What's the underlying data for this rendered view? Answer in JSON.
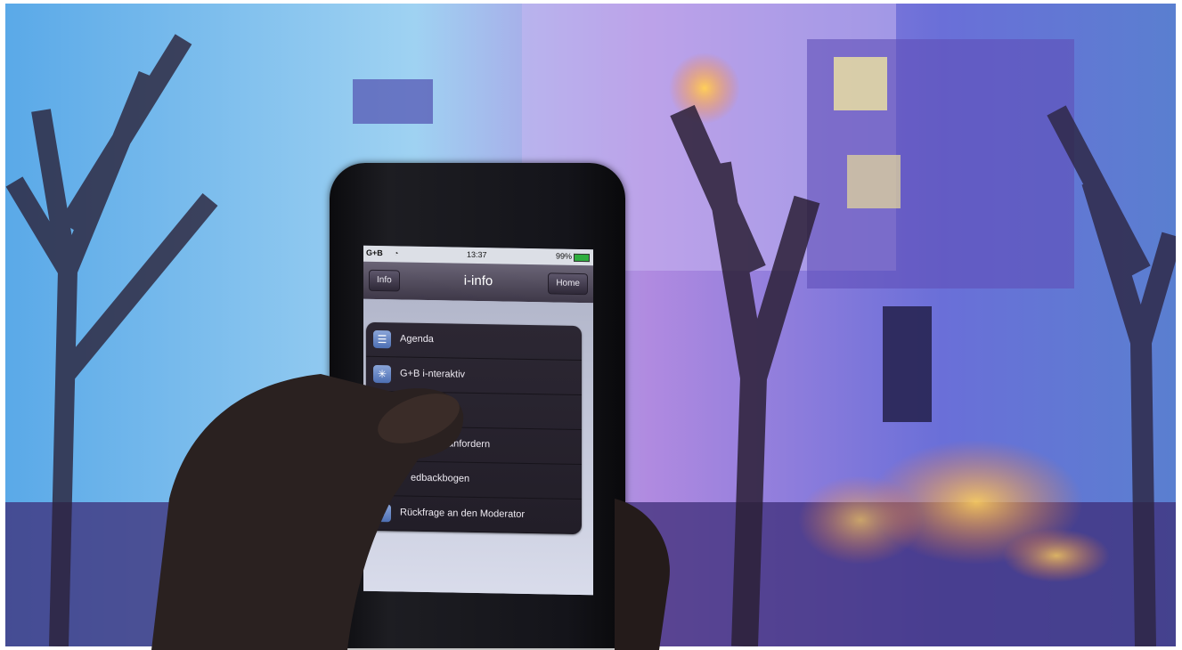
{
  "status": {
    "carrier": "G+B",
    "time": "13:37",
    "battery": "99%"
  },
  "nav": {
    "left_button": "Info",
    "title": "i-info",
    "right_button": "Home"
  },
  "menu": [
    {
      "label": "Agenda",
      "icon": "list-icon"
    },
    {
      "label": "G+B i-nteraktiv",
      "icon": "asterisk-icon"
    },
    {
      "label": "",
      "icon": "document-icon"
    },
    {
      "label": "anfordern",
      "icon": ""
    },
    {
      "label": "edbackbogen",
      "icon": ""
    },
    {
      "label": "Rückfrage an den Moderator",
      "icon": "speech-icon"
    }
  ]
}
